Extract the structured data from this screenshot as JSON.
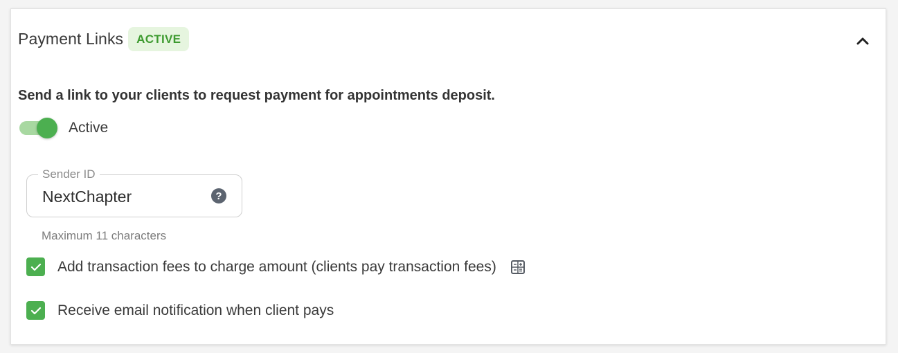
{
  "header": {
    "title": "Payment Links",
    "status_badge": "ACTIVE",
    "collapse_icon": "chevron-up-icon"
  },
  "description": "Send a link to your clients to request payment for appointments deposit.",
  "toggle": {
    "label": "Active",
    "on": true
  },
  "sender_id": {
    "legend": "Sender ID",
    "value": "NextChapter",
    "help_icon": "question-mark-icon",
    "hint": "Maximum 11 characters"
  },
  "options": [
    {
      "label": "Add transaction fees to charge amount (clients pay transaction fees)",
      "checked": true,
      "icon": "calculator-icon"
    },
    {
      "label": "Receive email notification when client pays",
      "checked": true
    }
  ],
  "colors": {
    "accent_green": "#4caf50",
    "badge_bg": "#e6f5df",
    "badge_text": "#3d9a2f",
    "toggle_track": "#a8d8a1"
  }
}
